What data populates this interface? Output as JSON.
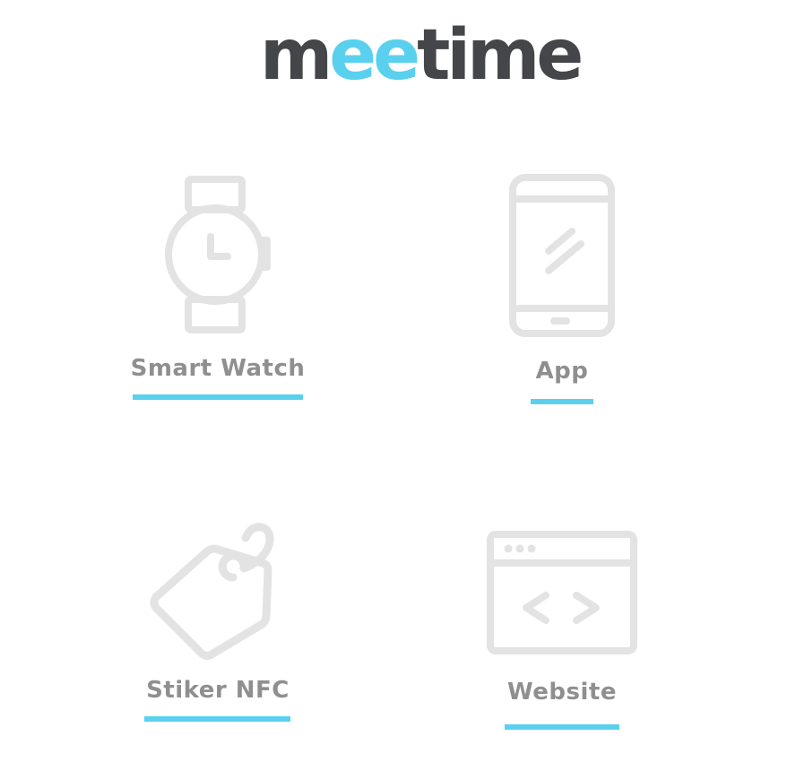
{
  "brand": {
    "prefix": "m",
    "accent": "ee",
    "suffix": "time",
    "text_color": "#444649",
    "accent_color": "#5ad0ef"
  },
  "options": [
    {
      "label": "Smart Watch",
      "icon": "watch-icon"
    },
    {
      "label": "App",
      "icon": "smartphone-icon"
    },
    {
      "label": "Stiker NFC",
      "icon": "tag-icon"
    },
    {
      "label": "Website",
      "icon": "code-window-icon"
    }
  ],
  "colors": {
    "icon_stroke": "#e3e3e4",
    "label": "#8f8f90",
    "underline": "#5ad0ef"
  }
}
